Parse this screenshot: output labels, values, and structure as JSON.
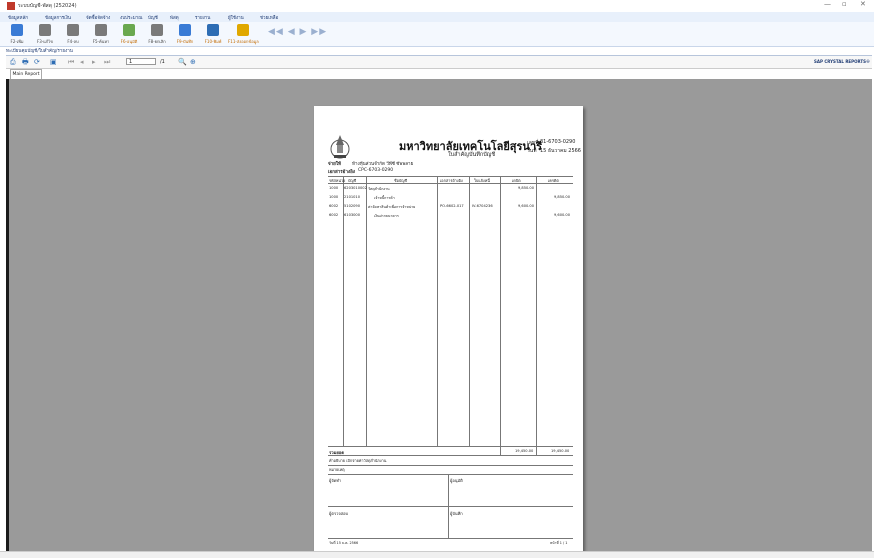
{
  "window": {
    "title": "ระบบบัญชี-พัสดุ (252024)",
    "minimize_glyph": "—",
    "maximize_glyph": "▫",
    "close_glyph": "✕"
  },
  "menu": [
    "ข้อมูลหลัก",
    "ข้อมูลการเงิน",
    "จัดซื้อจัดจ้าง",
    "งบประมาณ",
    "บัญชี",
    "พัสดุ",
    "รายงาน",
    "ผู้ใช้งาน",
    "ช่วยเหลือ"
  ],
  "toolbar": {
    "buttons": [
      {
        "label": "F2-เพิ่ม",
        "color": "#3a7bd5"
      },
      {
        "label": "F3-แก้ไข",
        "color": "#7a7a7a"
      },
      {
        "label": "F4-ลบ",
        "color": "#7a7a7a"
      },
      {
        "label": "F5-ค้นหา",
        "color": "#7a7a7a"
      },
      {
        "label": "F6-อนุมัติ",
        "color": "#6aa84f"
      },
      {
        "label": "F8-ยกเลิก",
        "color": "#7a7a7a"
      },
      {
        "label": "F9-บันทึก",
        "color": "#3a7bd5"
      },
      {
        "label": "F10-พิมพ์",
        "color": "#2e6db4"
      },
      {
        "label": "F11-ส่งออกข้อมูล",
        "color": "#e0a800"
      }
    ],
    "nav_arrows": "◀◀ ◀ ▶ ▶▶"
  },
  "breadcrumb": "ทะเบียนคุมบัญชี/ใบสำคัญ/รายงาน",
  "report_toolbar": {
    "page_value": "1",
    "page_of": "/1",
    "brand": "SAP CRYSTAL REPORTS®"
  },
  "tabs": [
    "Main Report"
  ],
  "document": {
    "org_name": "มหาวิทยาลัยเทคโนโลยีสุรนารี",
    "doc_type": "ใบสำคัญบันทึกบัญชี",
    "doc_no_label": "เลขที่",
    "doc_no": "31-6703-0290",
    "date_label": "วันที่",
    "date": "15 ธันวาคม 2566",
    "payee_label": "จ่ายให้",
    "payee": "ห้างหุ้นส่วนจำกัด วีพีซี ซัพพลาย",
    "ref_label": "เอกสารอ้างอิง",
    "ref": "CPC-6703-0290",
    "columns": [
      "รหัสหน่วย",
      "บัญชี",
      "ชื่อบัญชี",
      "เอกสารอ้างอิง",
      "ใบแจ้งหนี้",
      "เดบิต",
      "เครดิต"
    ],
    "rows": [
      {
        "unit": "1000",
        "account": "6203010002",
        "name": "วัสดุสำนักงาน",
        "ref": "",
        "inv": "",
        "debit": "9,850.00",
        "credit": ""
      },
      {
        "unit": "1000",
        "account": "2101010",
        "name": "เจ้าหนี้การค้า",
        "ref": "",
        "inv": "",
        "debit": "",
        "credit": "9,850.00"
      },
      {
        "unit": "6002",
        "account": "5102090",
        "name": "ค่าจัดหาสินค้าเพื่อการจำหน่าย",
        "ref": "PO-6602-017",
        "inv": "IV-6704236",
        "debit": "9,600.00",
        "credit": ""
      },
      {
        "unit": "6002",
        "account": "6103000",
        "name": "เงินฝากธนาคาร",
        "ref": "",
        "inv": "",
        "debit": "",
        "credit": "9,600.00"
      }
    ],
    "total_label": "รวมยอด",
    "total_debit": "19,450.00",
    "total_credit": "19,450.00",
    "note": "คำอธิบาย เบิกจ่ายค่าวัสดุสำนักงาน",
    "remark_label": "หมายเหตุ",
    "sig_prepared": "ผู้จัดทำ",
    "sig_approved": "ผู้อนุมัติ",
    "sig_checked": "ผู้ตรวจสอบ",
    "sig_recorded": "ผู้บันทึก",
    "printed_date": "วันที่ 15 ธ.ค. 2566",
    "page_footer": "หน้าที่ 1 / 1"
  }
}
